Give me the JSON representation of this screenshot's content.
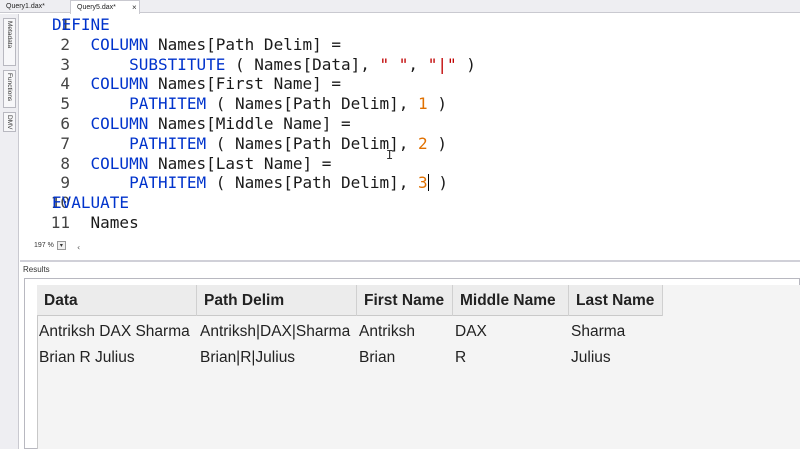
{
  "tabs": [
    {
      "label": "Query1.dax*"
    },
    {
      "label": "Query5.dax*",
      "close": "×"
    }
  ],
  "side_tabs": [
    "Metadata",
    "Functions",
    "DMV"
  ],
  "editor": {
    "line_numbers": [
      "1",
      "2",
      "3",
      "4",
      "5",
      "6",
      "7",
      "8",
      "9",
      "10",
      "11"
    ],
    "lines": [
      [
        {
          "t": "DEFINE",
          "c": "kw"
        }
      ],
      [
        {
          "t": "    COLUMN ",
          "c": "kw"
        },
        {
          "t": "Names[Path Delim] =",
          "c": "ident"
        }
      ],
      [
        {
          "t": "        SUBSTITUTE",
          "c": "fn"
        },
        {
          "t": " ( Names[Data], ",
          "c": "ident"
        },
        {
          "t": "\" \"",
          "c": "str"
        },
        {
          "t": ", ",
          "c": "ident"
        },
        {
          "t": "\"|\"",
          "c": "str"
        },
        {
          "t": " )",
          "c": "ident"
        }
      ],
      [
        {
          "t": "    COLUMN ",
          "c": "kw"
        },
        {
          "t": "Names[First Name] =",
          "c": "ident"
        }
      ],
      [
        {
          "t": "        PATHITEM",
          "c": "fn"
        },
        {
          "t": " ( Names[Path Delim], ",
          "c": "ident"
        },
        {
          "t": "1",
          "c": "num"
        },
        {
          "t": " )",
          "c": "ident"
        }
      ],
      [
        {
          "t": "    COLUMN ",
          "c": "kw"
        },
        {
          "t": "Names[Middle Name] =",
          "c": "ident"
        }
      ],
      [
        {
          "t": "        PATHITEM",
          "c": "fn"
        },
        {
          "t": " ( Names[Path Delim], ",
          "c": "ident"
        },
        {
          "t": "2",
          "c": "num"
        },
        {
          "t": " )",
          "c": "ident"
        }
      ],
      [
        {
          "t": "    COLUMN ",
          "c": "kw"
        },
        {
          "t": "Names[Last Name] =",
          "c": "ident"
        }
      ],
      [
        {
          "t": "        PATHITEM",
          "c": "fn"
        },
        {
          "t": " ( Names[Path Delim], ",
          "c": "ident"
        },
        {
          "t": "3",
          "c": "num"
        },
        {
          "t": "|",
          "c": "caret"
        },
        {
          "t": " )",
          "c": "ident"
        }
      ],
      [
        {
          "t": "EVALUATE",
          "c": "kw"
        }
      ],
      [
        {
          "t": "    Names",
          "c": "ident"
        }
      ]
    ],
    "zoom": "197 %",
    "zoom_drop": "▾"
  },
  "results": {
    "label": "Results",
    "columns": [
      {
        "name": "Data"
      },
      {
        "name": "Path Delim"
      },
      {
        "name": "First Name"
      },
      {
        "name": "Middle Name"
      },
      {
        "name": "Last Name"
      }
    ],
    "rows": [
      [
        "Antriksh DAX Sharma",
        "Antriksh|DAX|Sharma",
        "Antriksh",
        "DAX",
        "Sharma"
      ],
      [
        "Brian R Julius",
        "Brian|R|Julius",
        "Brian",
        "R",
        "Julius"
      ]
    ]
  }
}
